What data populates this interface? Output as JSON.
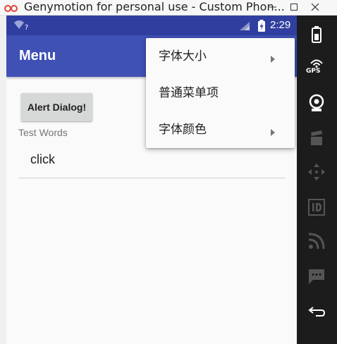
{
  "window": {
    "title": "Genymotion for personal use - Custom Phon...",
    "controls": [
      "minimize",
      "maximize",
      "close"
    ]
  },
  "status_bar": {
    "time": "2:29",
    "wifi_mark": "?",
    "icons": [
      "wifi-icon",
      "signal-icon",
      "battery-icon"
    ]
  },
  "app_bar": {
    "title": "Menu",
    "color": "#3f51b5",
    "status_color": "#303f9f"
  },
  "content": {
    "alert_button_label": "Alert Dialog!",
    "label": "Test Words",
    "edit_text_value": "click"
  },
  "popup_menu": {
    "items": [
      {
        "label": "字体大小",
        "has_submenu": true
      },
      {
        "label": "普通菜单项",
        "has_submenu": false
      },
      {
        "label": "字体颜色",
        "has_submenu": true
      }
    ]
  },
  "side_panel": {
    "gps_label": "GPS",
    "icons": [
      "battery-icon",
      "gps-icon",
      "webcam-icon",
      "capture-icon",
      "move-icon",
      "id-icon",
      "rss-icon",
      "message-icon",
      "back-icon"
    ]
  }
}
